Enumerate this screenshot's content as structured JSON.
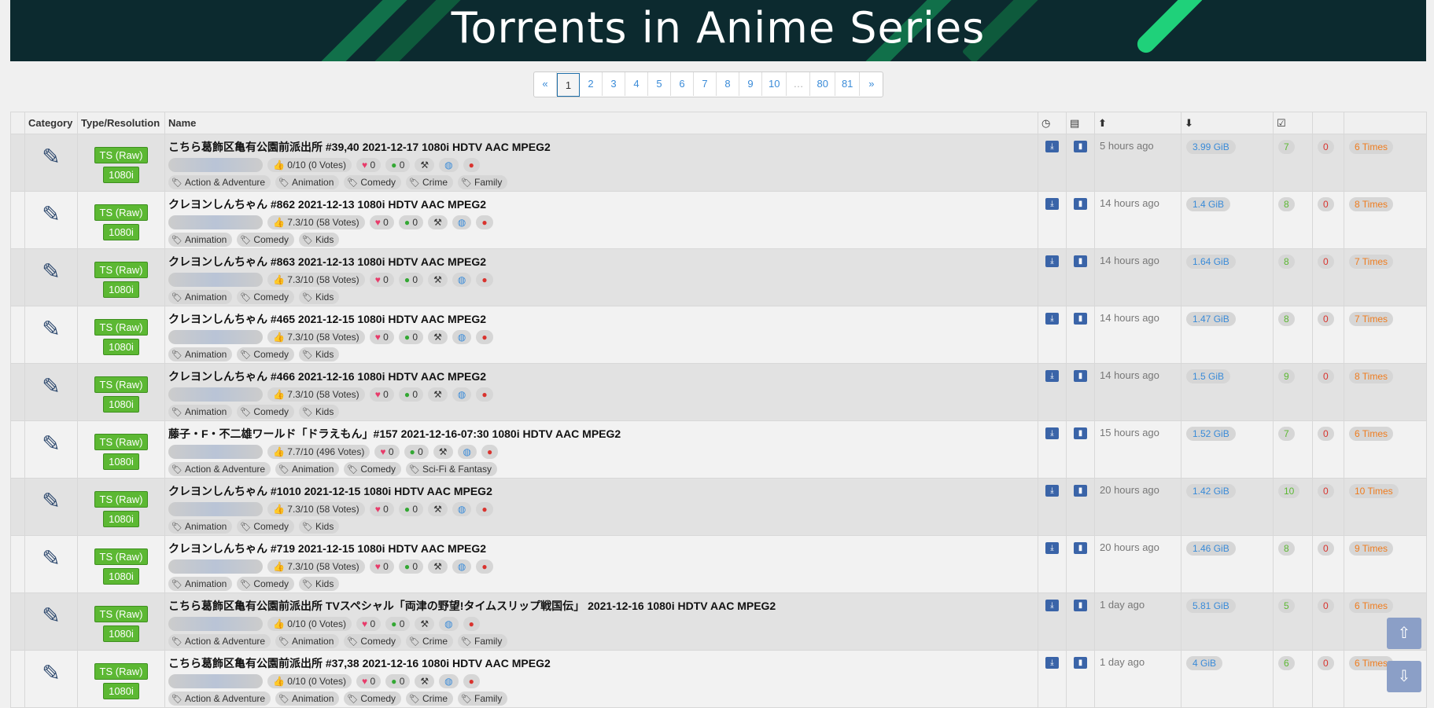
{
  "banner": {
    "title": "Torrents in Anime Series"
  },
  "pagination": {
    "pages": [
      "«",
      "1",
      "2",
      "3",
      "4",
      "5",
      "6",
      "7",
      "8",
      "9",
      "10",
      "…",
      "80",
      "81",
      "»"
    ],
    "current": "1"
  },
  "columns": {
    "category": "Category",
    "type": "Type/Resolution",
    "name": "Name"
  },
  "rows": [
    {
      "title": "こちら葛飾区亀有公園前派出所 #39,40 2021-12-17 1080i HDTV AAC MPEG2",
      "type": "TS (Raw)",
      "res": "1080i",
      "rating": "0/10 (0 Votes)",
      "likes": "0",
      "comments": "0",
      "tags": [
        "Action & Adventure",
        "Animation",
        "Comedy",
        "Crime",
        "Family"
      ],
      "age": "5 hours ago",
      "size": "3.99 GiB",
      "seeders": "7",
      "leechers": "0",
      "completed": "6 Times"
    },
    {
      "title": "クレヨンしんちゃん #862 2021-12-13 1080i HDTV AAC MPEG2",
      "type": "TS (Raw)",
      "res": "1080i",
      "rating": "7.3/10 (58 Votes)",
      "likes": "0",
      "comments": "0",
      "tags": [
        "Animation",
        "Comedy",
        "Kids"
      ],
      "age": "14 hours ago",
      "size": "1.4 GiB",
      "seeders": "8",
      "leechers": "0",
      "completed": "8 Times"
    },
    {
      "title": "クレヨンしんちゃん #863 2021-12-13 1080i HDTV AAC MPEG2",
      "type": "TS (Raw)",
      "res": "1080i",
      "rating": "7.3/10 (58 Votes)",
      "likes": "0",
      "comments": "0",
      "tags": [
        "Animation",
        "Comedy",
        "Kids"
      ],
      "age": "14 hours ago",
      "size": "1.64 GiB",
      "seeders": "8",
      "leechers": "0",
      "completed": "7 Times"
    },
    {
      "title": "クレヨンしんちゃん #465 2021-12-15 1080i HDTV AAC MPEG2",
      "type": "TS (Raw)",
      "res": "1080i",
      "rating": "7.3/10 (58 Votes)",
      "likes": "0",
      "comments": "0",
      "tags": [
        "Animation",
        "Comedy",
        "Kids"
      ],
      "age": "14 hours ago",
      "size": "1.47 GiB",
      "seeders": "8",
      "leechers": "0",
      "completed": "7 Times"
    },
    {
      "title": "クレヨンしんちゃん #466 2021-12-16 1080i HDTV AAC MPEG2",
      "type": "TS (Raw)",
      "res": "1080i",
      "rating": "7.3/10 (58 Votes)",
      "likes": "0",
      "comments": "0",
      "tags": [
        "Animation",
        "Comedy",
        "Kids"
      ],
      "age": "14 hours ago",
      "size": "1.5 GiB",
      "seeders": "9",
      "leechers": "0",
      "completed": "8 Times"
    },
    {
      "title": "藤子・F・不二雄ワールド「ドラえもん」#157 2021-12-16-07:30 1080i HDTV AAC MPEG2",
      "type": "TS (Raw)",
      "res": "1080i",
      "rating": "7.7/10 (496 Votes)",
      "likes": "0",
      "comments": "0",
      "tags": [
        "Action & Adventure",
        "Animation",
        "Comedy",
        "Sci-Fi & Fantasy"
      ],
      "age": "15 hours ago",
      "size": "1.52 GiB",
      "seeders": "7",
      "leechers": "0",
      "completed": "6 Times"
    },
    {
      "title": "クレヨンしんちゃん #1010 2021-12-15 1080i HDTV AAC MPEG2",
      "type": "TS (Raw)",
      "res": "1080i",
      "rating": "7.3/10 (58 Votes)",
      "likes": "0",
      "comments": "0",
      "tags": [
        "Animation",
        "Comedy",
        "Kids"
      ],
      "age": "20 hours ago",
      "size": "1.42 GiB",
      "seeders": "10",
      "leechers": "0",
      "completed": "10 Times"
    },
    {
      "title": "クレヨンしんちゃん #719 2021-12-15 1080i HDTV AAC MPEG2",
      "type": "TS (Raw)",
      "res": "1080i",
      "rating": "7.3/10 (58 Votes)",
      "likes": "0",
      "comments": "0",
      "tags": [
        "Animation",
        "Comedy",
        "Kids"
      ],
      "age": "20 hours ago",
      "size": "1.46 GiB",
      "seeders": "8",
      "leechers": "0",
      "completed": "9 Times"
    },
    {
      "title": "こちら葛飾区亀有公園前派出所 TVスペシャル「両津の野望!タイムスリップ戦国伝」 2021-12-16 1080i HDTV AAC MPEG2",
      "type": "TS (Raw)",
      "res": "1080i",
      "rating": "0/10 (0 Votes)",
      "likes": "0",
      "comments": "0",
      "tags": [
        "Action & Adventure",
        "Animation",
        "Comedy",
        "Crime",
        "Family"
      ],
      "age": "1 day ago",
      "size": "5.81 GiB",
      "seeders": "5",
      "leechers": "0",
      "completed": "6 Times"
    },
    {
      "title": "こちら葛飾区亀有公園前派出所 #37,38 2021-12-16 1080i HDTV AAC MPEG2",
      "type": "TS (Raw)",
      "res": "1080i",
      "rating": "0/10 (0 Votes)",
      "likes": "0",
      "comments": "0",
      "tags": [
        "Action & Adventure",
        "Animation",
        "Comedy",
        "Crime",
        "Family"
      ],
      "age": "1 day ago",
      "size": "4 GiB",
      "seeders": "6",
      "leechers": "0",
      "completed": "6 Times"
    }
  ],
  "colors": {
    "banner_bg": "#0c2a2f",
    "accent_green": "#1fd17a",
    "type_badge": "#5cb833",
    "link_blue": "#3a8bd8"
  },
  "icons": {
    "category": "pencil-icon",
    "download": "download-icon",
    "bookmark": "bookmark-icon",
    "age": "clock-icon",
    "files": "file-icon",
    "seeders": "arrow-up-circle-icon",
    "leechers": "arrow-down-circle-icon",
    "completed": "check-square-icon"
  }
}
